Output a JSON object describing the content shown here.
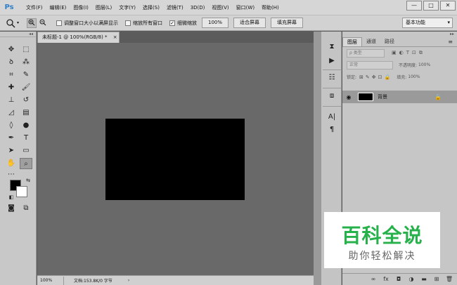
{
  "menubar": {
    "logo": "Ps",
    "items": [
      "文件(F)",
      "编辑(E)",
      "图像(I)",
      "图层(L)",
      "文字(Y)",
      "选择(S)",
      "滤镜(T)",
      "3D(D)",
      "视图(V)",
      "窗口(W)",
      "帮助(H)"
    ],
    "win_min": "—",
    "win_max": "□",
    "win_close": "✕"
  },
  "optbar": {
    "tool_icon": "zoom-icon",
    "checkbox_resize": "调整窗口大小以满屏显示",
    "checkbox_zoom_all": "缩放所有窗口",
    "checkbox_scrubby": "细微缩放",
    "zoom_value": "100%",
    "fit_screen": "适合屏幕",
    "fill_screen": "填充屏幕",
    "workspace": "基本功能"
  },
  "document": {
    "tab_title": "未标题-1 @ 100%(RGB/8) *",
    "zoom": "100%",
    "info": "文档:153.8K/0 字节"
  },
  "layers_panel": {
    "tabs": [
      "图层",
      "通道",
      "路径"
    ],
    "filter_label": "ρ 类型",
    "blend_mode": "正常",
    "opacity_label": "不透明度:",
    "opacity_value": "100%",
    "lock_label": "锁定:",
    "fill_label": "填充:",
    "fill_value": "100%",
    "layer_name": "背景"
  },
  "watermark": {
    "big": "百科全说",
    "small": "助你轻松解决"
  },
  "colors": {
    "foreground": "#000000",
    "background": "#ffffff",
    "canvas_fill": "#000000",
    "watermark_green": "#26b14a"
  }
}
